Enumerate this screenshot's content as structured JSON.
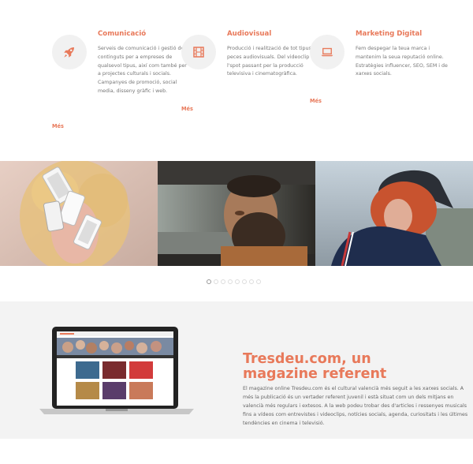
{
  "services": [
    {
      "title": "Comunicació",
      "icon": "rocket-icon",
      "description": "Serveis de comunicació i gestió de continguts per a empreses de qualsevol tipus, així com també per a projectes culturals i socials. Campanyes de promoció, social media, disseny gràfic i web.",
      "more": "Més"
    },
    {
      "title": "Audiovisual",
      "icon": "film-icon",
      "description": "Producció i realització de tot tipus de peces audiovisuals. Del videoclip a l'spot passant per la producció televisiva i cinematogràfica.",
      "more": "Més"
    },
    {
      "title": "Marketing Digital",
      "icon": "laptop-icon",
      "description": "Fem despegar la teua marca i mantenim la seua reputació online. Estratègies influencer, SEO, SEM i de xarxes socials.",
      "more": "Més"
    }
  ],
  "slider": {
    "slides": [
      "phones-portrait-slide",
      "driver-portrait-slide",
      "cap-girl-slide"
    ],
    "dot_count": 8,
    "active_dot": 0
  },
  "magazine": {
    "title": "Tresdeu.com, un magazine referent",
    "text": "El magazine online Tresdeu.com és el cultural valencià més seguit a les xarxes socials. A més la publicació és un vertader referent juvenil i està situat com un dels mitjans en valencià més regulars i extesos. A la web podeu trobar des d'articles i ressenyes musicals fins a vídeos com entrevistes i videoclips, notícies socials, agenda, curiositats i les últimes tendències en cinema i televisió."
  },
  "colors": {
    "accent": "#e8795a",
    "icon_bg": "#f1f1f1",
    "section_bg": "#f3f3f3"
  }
}
